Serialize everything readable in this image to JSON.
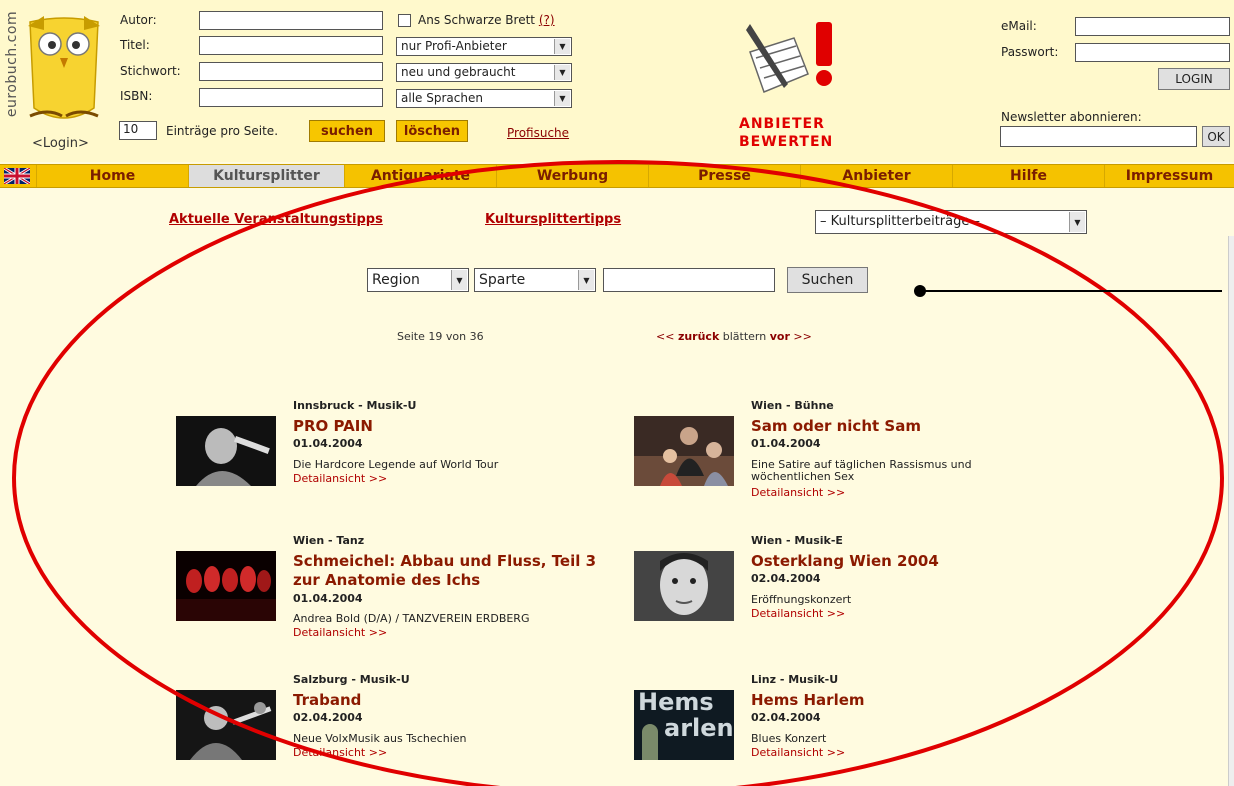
{
  "brand": {
    "name": "eurobuch.com",
    "login_link": "<Login>"
  },
  "search_form": {
    "author_label": "Autor:",
    "title_label": "Titel:",
    "keyword_label": "Stichwort:",
    "isbn_label": "ISBN:",
    "board_label": "Ans Schwarze Brett",
    "board_help": "(?)",
    "seller_select": "nur Profi-Anbieter",
    "condition_select": "neu und gebraucht",
    "language_select": "alle Sprachen",
    "per_page_value": "10",
    "per_page_label": "Einträge pro Seite.",
    "search_button": "suchen",
    "clear_button": "löschen",
    "advanced_link": "Profisuche"
  },
  "rate_banner": {
    "line1": "ANBIETER",
    "line2": "BEWERTEN"
  },
  "login_box": {
    "email_label": "eMail:",
    "password_label": "Passwort:",
    "login_button": "LOGIN",
    "newsletter_label": "Newsletter abonnieren:",
    "ok_button": "OK"
  },
  "nav": {
    "items": [
      "Home",
      "Kultursplitter",
      "Antiquariate",
      "Werbung",
      "Presse",
      "Anbieter",
      "Hilfe",
      "Impressum"
    ],
    "active": "Kultursplitter"
  },
  "content": {
    "link_events": "Aktuelle Veranstaltungstipps",
    "link_tips": "Kultursplittertipps",
    "articles_select": "– Kultursplitterbeiträge –",
    "region_select": "Region",
    "genre_select": "Sparte",
    "search_input_value": "",
    "search_button": "Suchen",
    "page_info": "Seite 19 von 36",
    "pager_prev": "<< ",
    "pager_prev_word": "zurück",
    "pager_mid": " blättern ",
    "pager_next_word": "vor",
    "pager_next": " >>"
  },
  "items": [
    {
      "meta": "Innsbruck - Musik-U",
      "title": "PRO PAIN",
      "date": "01.04.2004",
      "desc": "Die Hardcore Legende auf World Tour",
      "more": "Detailansicht >>"
    },
    {
      "meta": "Wien - Bühne",
      "title": "Sam oder nicht Sam",
      "date": "01.04.2004",
      "desc": "Eine Satire auf täglichen Rassismus und wöchentlichen Sex",
      "more": "Detailansicht >>"
    },
    {
      "meta": "Wien - Tanz",
      "title": "Schmeichel: Abbau und Fluss, Teil 3 zur Anatomie des Ichs",
      "date": "01.04.2004",
      "desc": "Andrea Bold (D/A) / TANZVEREIN ERDBERG",
      "more": "Detailansicht >>"
    },
    {
      "meta": "Wien - Musik-E",
      "title": "Osterklang Wien 2004",
      "date": "02.04.2004",
      "desc": "Eröffnungskonzert",
      "more": "Detailansicht >>"
    },
    {
      "meta": "Salzburg - Musik-U",
      "title": "Traband",
      "date": "02.04.2004",
      "desc": "Neue VolxMusik aus Tschechien",
      "more": "Detailansicht >>"
    },
    {
      "meta": "Linz - Musik-U",
      "title": "Hems Harlem",
      "date": "02.04.2004",
      "desc": "Blues Konzert",
      "more": "Detailansicht >>"
    }
  ],
  "thumb_text": {
    "hems": "Hems",
    "harlem": "arlen"
  },
  "colors": {
    "page_bg": "#fffbe0",
    "nav_bg": "#f5c200",
    "accent_red": "#b00000",
    "annotation_red": "#e00000"
  }
}
